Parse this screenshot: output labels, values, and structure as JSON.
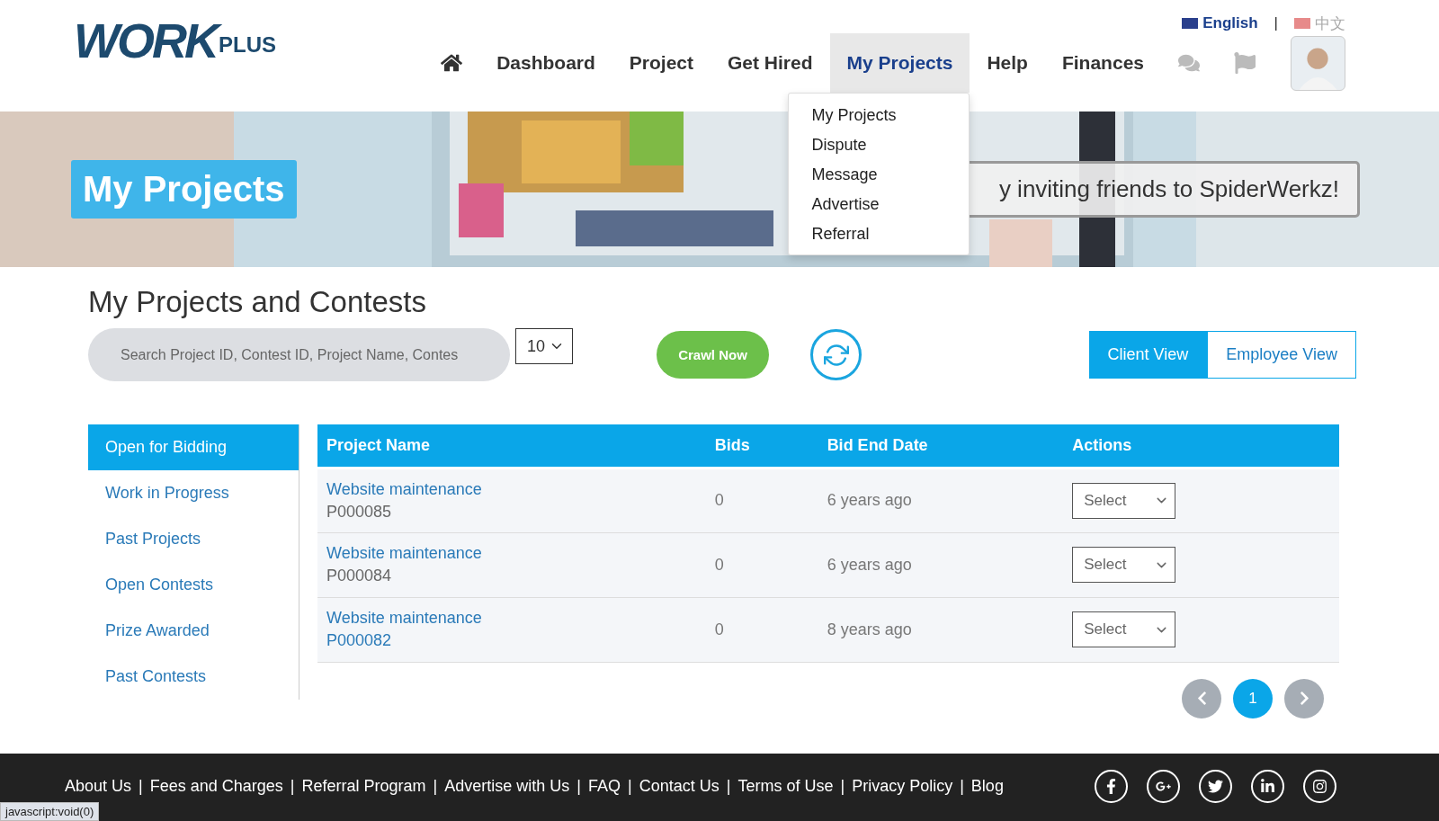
{
  "header": {
    "logo": {
      "main": "WORK",
      "sub": "PLUS"
    },
    "languages": [
      {
        "label": "English",
        "selected": true
      },
      {
        "label": "中文",
        "selected": false
      }
    ],
    "language_separator": "|",
    "nav": [
      {
        "kind": "home",
        "selected": false
      },
      {
        "kind": "link",
        "label": "Dashboard",
        "selected": false
      },
      {
        "kind": "link",
        "label": "Project",
        "selected": false
      },
      {
        "kind": "link",
        "label": "Get Hired",
        "selected": false
      },
      {
        "kind": "link",
        "label": "My Projects",
        "selected": true
      },
      {
        "kind": "link",
        "label": "Help",
        "selected": false
      },
      {
        "kind": "link",
        "label": "Finances",
        "selected": false
      }
    ]
  },
  "dropdown": {
    "items": [
      "My Projects",
      "Dispute",
      "Message",
      "Advertise",
      "Referral"
    ]
  },
  "banner": {
    "title": "My Projects",
    "message": "y inviting friends to SpiderWerkz!"
  },
  "section": {
    "title": "My Projects and Contests",
    "search": {
      "placeholder": "Search Project ID, Contest ID, Project Name, Contes"
    },
    "page_size": "10",
    "crawl_button": "Crawl Now",
    "views": [
      {
        "label": "Client View",
        "selected": true
      },
      {
        "label": "Employee View",
        "selected": false
      }
    ]
  },
  "sidebar": {
    "items": [
      {
        "label": "Open for Bidding",
        "selected": true
      },
      {
        "label": "Work in Progress",
        "selected": false
      },
      {
        "label": "Past Projects",
        "selected": false
      },
      {
        "label": "Open Contests",
        "selected": false
      },
      {
        "label": "Prize Awarded",
        "selected": false
      },
      {
        "label": "Past Contests",
        "selected": false
      }
    ]
  },
  "table": {
    "columns": [
      "Project Name",
      "Bids",
      "Bid End Date",
      "Actions"
    ],
    "rows": [
      {
        "name": "Website maintenance",
        "id": "P000085",
        "id_highlighted": false,
        "bids": "0",
        "end_date": "6 years ago",
        "action": "Select"
      },
      {
        "name": "Website maintenance",
        "id": "P000084",
        "id_highlighted": false,
        "bids": "0",
        "end_date": "6 years ago",
        "action": "Select"
      },
      {
        "name": "Website maintenance",
        "id": "P000082",
        "id_highlighted": true,
        "bids": "0",
        "end_date": "8 years ago",
        "action": "Select"
      }
    ]
  },
  "pagination": {
    "pages": [
      {
        "label": "1",
        "selected": true
      }
    ]
  },
  "footer": {
    "separator": "|",
    "links": [
      "About Us",
      "Fees and Charges",
      "Referral Program",
      "Advertise with Us",
      "FAQ",
      "Contact Us",
      "Terms of Use",
      "Privacy Policy",
      "Blog"
    ]
  },
  "status_bar": "javascript:void(0)"
}
